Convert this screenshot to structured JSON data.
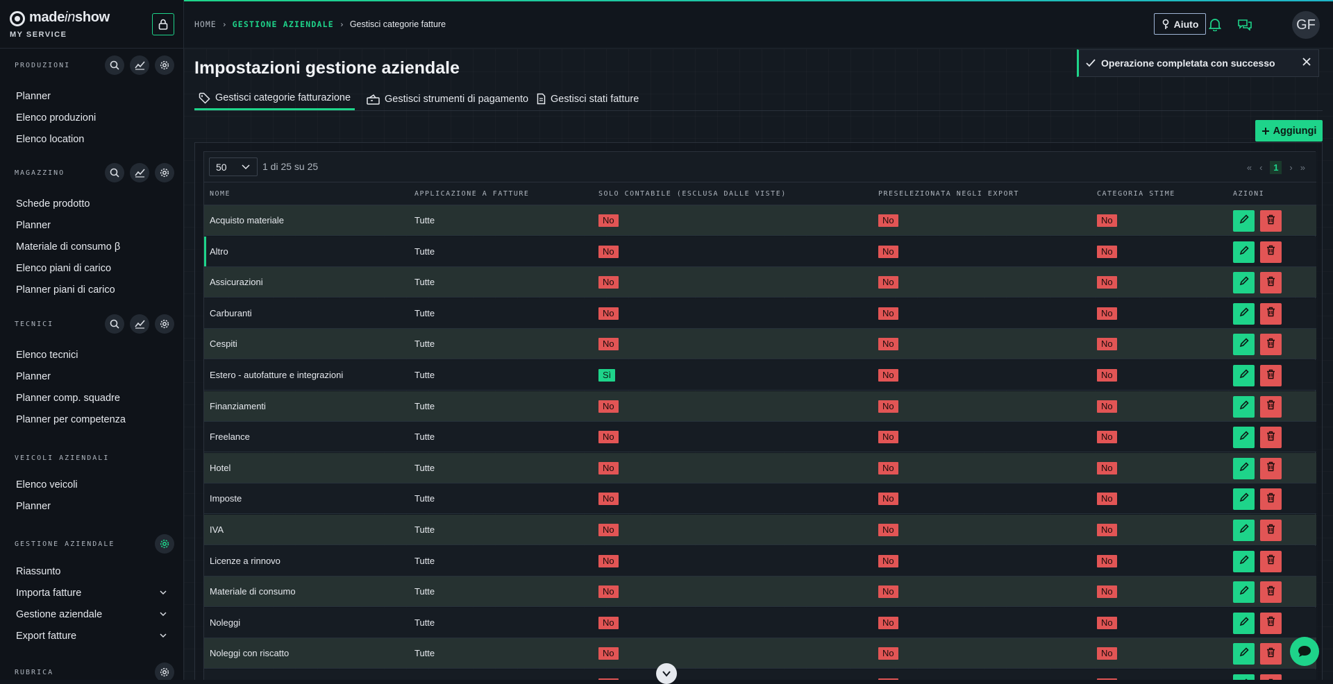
{
  "brand": {
    "name_a": "made",
    "name_b": "in",
    "name_c": "show",
    "subtitle": "MY SERVICE"
  },
  "sidebar": {
    "sections": [
      {
        "title": "PRODUZIONI",
        "items": [
          "Planner",
          "Elenco produzioni",
          "Elenco location"
        ]
      },
      {
        "title": "MAGAZZINO",
        "items": [
          "Schede prodotto",
          "Planner",
          "Materiale di consumo β",
          "Elenco piani di carico",
          "Planner piani di carico"
        ]
      },
      {
        "title": "TECNICI",
        "items": [
          "Elenco tecnici",
          "Planner",
          "Planner comp. squadre",
          "Planner per competenza"
        ]
      },
      {
        "title": "VEICOLI AZIENDALI",
        "items": [
          "Elenco veicoli",
          "Planner"
        ]
      },
      {
        "title": "GESTIONE AZIENDALE",
        "items": [
          "Riassunto",
          "Importa fatture",
          "Gestione aziendale",
          "Export fatture"
        ]
      },
      {
        "title": "RUBRICA",
        "items": []
      }
    ]
  },
  "header": {
    "breadcrumb": {
      "home": "HOME",
      "section": "GESTIONE AZIENDALE",
      "current": "Gestisci categorie fatture"
    },
    "help_label": "Aiuto",
    "avatar_initials": "GF"
  },
  "main": {
    "title": "Impostazioni gestione aziendale",
    "tabs": [
      {
        "label": "Gestisci categorie fatturazione",
        "icon": "tag-icon"
      },
      {
        "label": "Gestisci strumenti di pagamento",
        "icon": "payment-icon"
      },
      {
        "label": "Gestisci stati fatture",
        "icon": "document-icon"
      }
    ],
    "toast": "Operazione completata con successo",
    "add_label": "Aggiungi"
  },
  "table": {
    "page_size": "50",
    "range": "1 di 25 su 25",
    "current_page": "1",
    "columns": [
      "NOME",
      "APPLICAZIONE A FATTURE",
      "SOLO CONTABILE (ESCLUSA DALLE VISTE)",
      "PRESELEZIONATA NEGLI EXPORT",
      "CATEGORIA STIME",
      "AZIONI"
    ],
    "rows": [
      {
        "name": "Acquisto materiale",
        "app": "Tutte",
        "solo": "No",
        "presel": "No",
        "stime": "No"
      },
      {
        "name": "Altro",
        "app": "Tutte",
        "solo": "No",
        "presel": "No",
        "stime": "No"
      },
      {
        "name": "Assicurazioni",
        "app": "Tutte",
        "solo": "No",
        "presel": "No",
        "stime": "No"
      },
      {
        "name": "Carburanti",
        "app": "Tutte",
        "solo": "No",
        "presel": "No",
        "stime": "No"
      },
      {
        "name": "Cespiti",
        "app": "Tutte",
        "solo": "No",
        "presel": "No",
        "stime": "No"
      },
      {
        "name": "Estero - autofatture e integrazioni",
        "app": "Tutte",
        "solo": "Sì",
        "presel": "No",
        "stime": "No"
      },
      {
        "name": "Finanziamenti",
        "app": "Tutte",
        "solo": "No",
        "presel": "No",
        "stime": "No"
      },
      {
        "name": "Freelance",
        "app": "Tutte",
        "solo": "No",
        "presel": "No",
        "stime": "No"
      },
      {
        "name": "Hotel",
        "app": "Tutte",
        "solo": "No",
        "presel": "No",
        "stime": "No"
      },
      {
        "name": "Imposte",
        "app": "Tutte",
        "solo": "No",
        "presel": "No",
        "stime": "No"
      },
      {
        "name": "IVA",
        "app": "Tutte",
        "solo": "No",
        "presel": "No",
        "stime": "No"
      },
      {
        "name": "Licenze a rinnovo",
        "app": "Tutte",
        "solo": "No",
        "presel": "No",
        "stime": "No"
      },
      {
        "name": "Materiale di consumo",
        "app": "Tutte",
        "solo": "No",
        "presel": "No",
        "stime": "No"
      },
      {
        "name": "Noleggi",
        "app": "Tutte",
        "solo": "No",
        "presel": "No",
        "stime": "No"
      },
      {
        "name": "Noleggi con riscatto",
        "app": "Tutte",
        "solo": "No",
        "presel": "No",
        "stime": "No"
      },
      {
        "name": "",
        "app": "",
        "solo": "No",
        "presel": "No",
        "stime": "No"
      }
    ]
  },
  "colors": {
    "accent": "#1ed48a",
    "danger": "#e25555",
    "bg": "#11161d"
  }
}
